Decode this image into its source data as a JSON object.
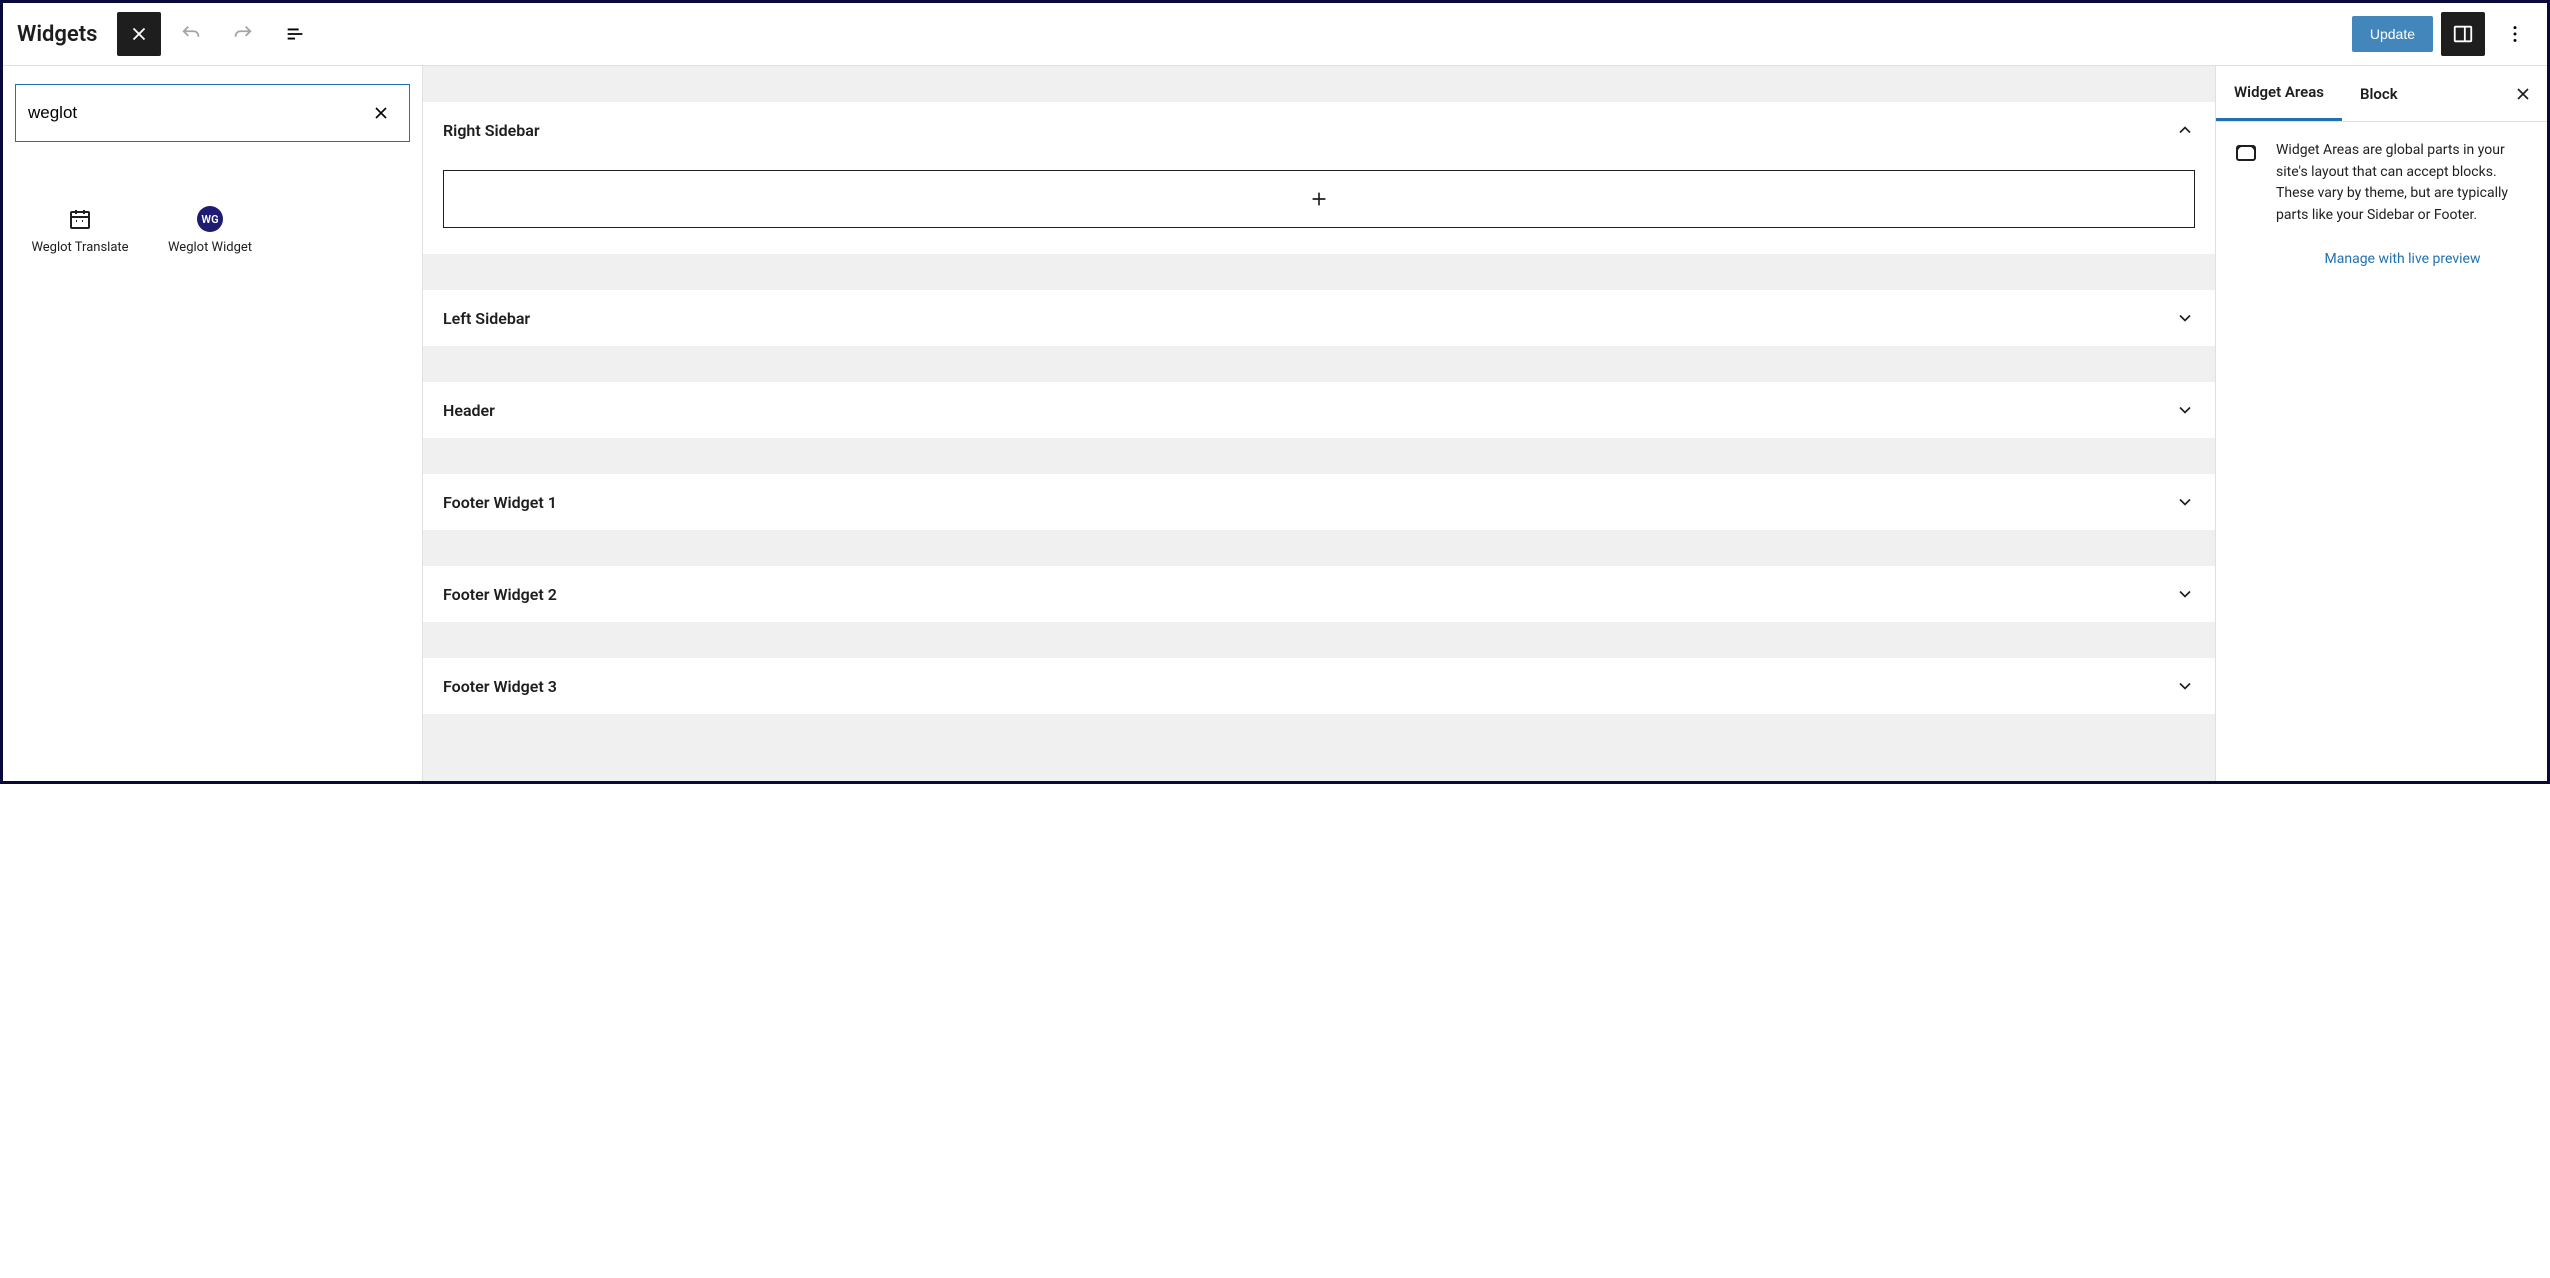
{
  "header": {
    "title": "Widgets",
    "update_label": "Update"
  },
  "search": {
    "value": "weglot"
  },
  "blocks": [
    {
      "label": "Weglot Translate",
      "icon": "calendar"
    },
    {
      "label": "Weglot Widget",
      "icon": "wg"
    }
  ],
  "areas": [
    {
      "label": "Right Sidebar",
      "expanded": true
    },
    {
      "label": "Left Sidebar",
      "expanded": false
    },
    {
      "label": "Header",
      "expanded": false
    },
    {
      "label": "Footer Widget 1",
      "expanded": false
    },
    {
      "label": "Footer Widget 2",
      "expanded": false
    },
    {
      "label": "Footer Widget 3",
      "expanded": false
    }
  ],
  "right": {
    "tabs": {
      "areas": "Widget Areas",
      "block": "Block"
    },
    "description": "Widget Areas are global parts in your site's layout that can accept blocks. These vary by theme, but are typically parts like your Sidebar or Footer.",
    "manage_link": "Manage with live preview"
  }
}
